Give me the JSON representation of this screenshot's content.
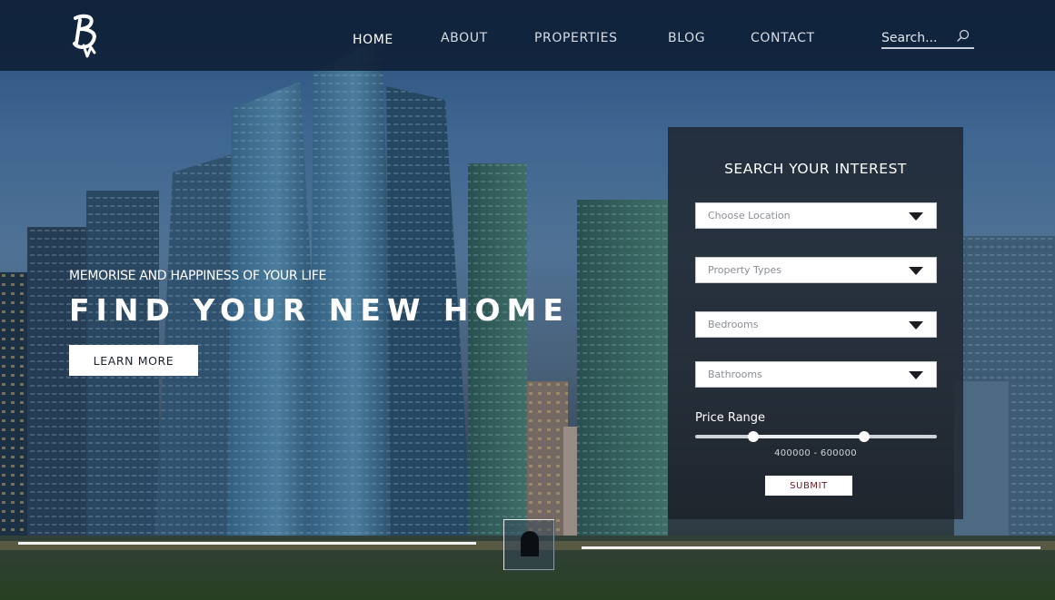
{
  "header": {
    "logo_alt": "B",
    "nav": [
      {
        "label": "HOME",
        "active": true
      },
      {
        "label": "ABOUT",
        "active": false
      },
      {
        "label": "PROPERTIES",
        "active": false
      },
      {
        "label": "BLOG",
        "active": false
      },
      {
        "label": "CONTACT",
        "active": false
      }
    ],
    "search": {
      "placeholder": "Search..."
    }
  },
  "hero": {
    "subtitle": "MEMORISE AND HAPPINESS OF YOUR LIFE",
    "title": "FIND YOUR NEW HOME",
    "button_label": "LEARN MORE"
  },
  "search_panel": {
    "title": "SEARCH YOUR INTEREST",
    "selects": [
      {
        "label": "Choose Location"
      },
      {
        "label": "Property Types"
      },
      {
        "label": "Bedrooms"
      },
      {
        "label": "Bathrooms"
      }
    ],
    "price_range": {
      "label": "Price Range",
      "display": "400000 - 600000",
      "min_fraction": 0.24,
      "max_fraction": 0.7
    },
    "submit_label": "SUBMIT"
  },
  "slider": {
    "active_index": 1
  },
  "colors": {
    "header_bg": "#0e1e34",
    "panel_bg": "#1c2028",
    "submit_text": "#6b1a22"
  }
}
